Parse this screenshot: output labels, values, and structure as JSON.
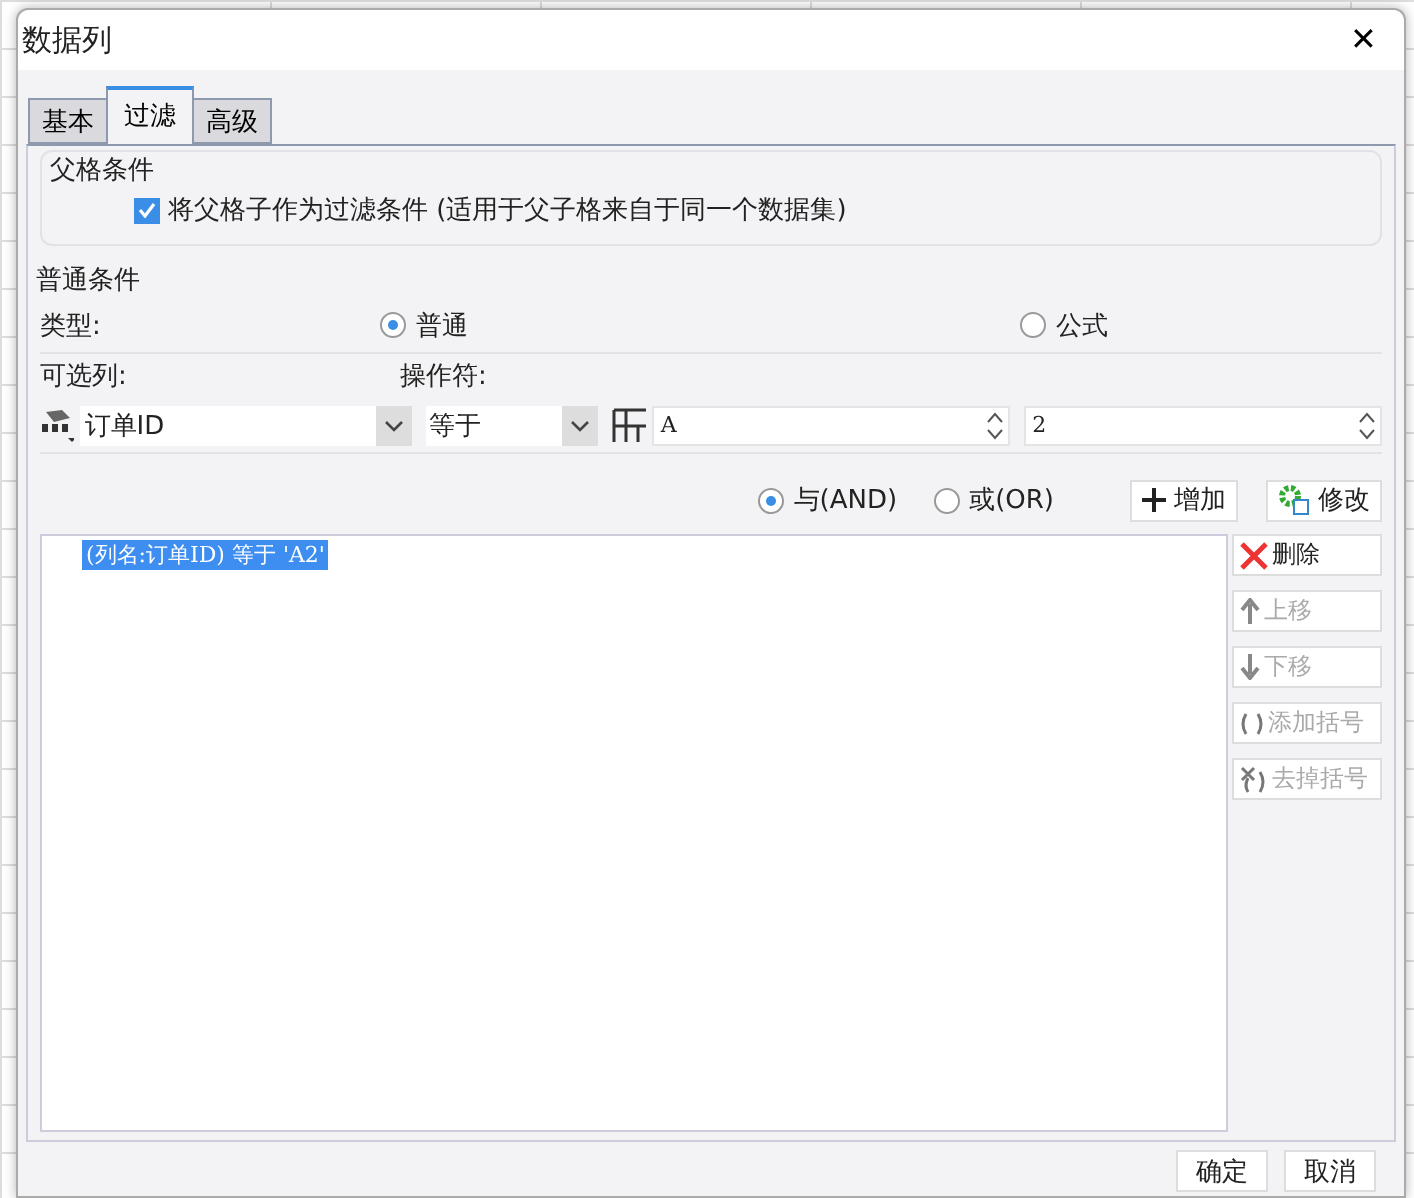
{
  "window": {
    "title": "数据列",
    "close": "✕"
  },
  "tabs": [
    {
      "label": "基本",
      "selected": false
    },
    {
      "label": "过滤",
      "selected": true
    },
    {
      "label": "高级",
      "selected": false
    }
  ],
  "parent_condition": {
    "legend": "父格条件",
    "checkbox": {
      "label": "将父格子作为过滤条件 (适用于父子格来自于同一个数据集)",
      "checked": true
    }
  },
  "normal_condition": {
    "legend": "普通条件",
    "type_label": "类型:",
    "type_options": [
      {
        "label": "普通",
        "selected": true
      },
      {
        "label": "公式",
        "selected": false
      }
    ],
    "column_label": "可选列:",
    "operator_label": "操作符:",
    "column_value": "订单ID",
    "operator_value": "等于",
    "value_1": "A",
    "value_2": "2"
  },
  "join_options": [
    {
      "label": "与(AND)",
      "selected": true
    },
    {
      "label": "或(OR)",
      "selected": false
    }
  ],
  "top_buttons": [
    {
      "label": "增加",
      "kind": "add"
    },
    {
      "label": "修改",
      "kind": "modify"
    }
  ],
  "conditions": [
    {
      "text": "(列名:订单ID) 等于 'A2'",
      "selected": true
    }
  ],
  "side_buttons": [
    {
      "label": "删除",
      "kind": "delete",
      "disabled": false
    },
    {
      "label": "上移",
      "kind": "up",
      "disabled": true
    },
    {
      "label": "下移",
      "kind": "down",
      "disabled": true
    },
    {
      "label": "添加括号",
      "kind": "add-paren",
      "disabled": true
    },
    {
      "label": "去掉括号",
      "kind": "remove-paren",
      "disabled": true
    }
  ],
  "footer_buttons": [
    "确定",
    "取消"
  ]
}
